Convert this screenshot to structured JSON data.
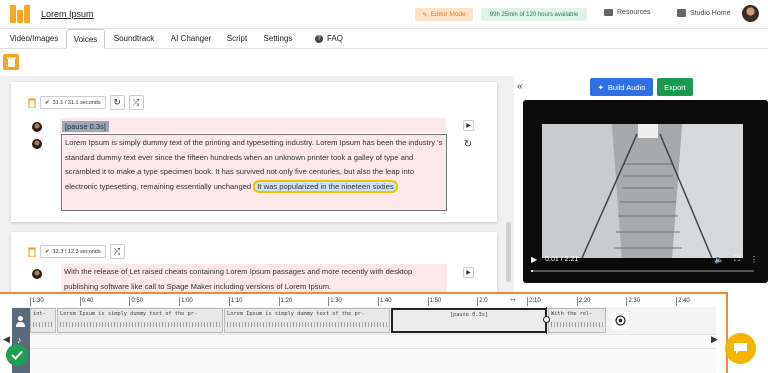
{
  "header": {
    "app_title": "Lorem Ipsum",
    "editor_mode": "Editor Mode",
    "hours": "99h 25min of 120 hours available",
    "resources": "Resources",
    "studio_home": "Studio Home"
  },
  "tabs": [
    {
      "label": "Video/Images"
    },
    {
      "label": "Voices"
    },
    {
      "label": "Soundtrack"
    },
    {
      "label": "AI Changer"
    },
    {
      "label": "Script"
    },
    {
      "label": "Settings"
    },
    {
      "label": "FAQ"
    }
  ],
  "blocks": [
    {
      "duration": "31.1 / 31.1 seconds",
      "pause": "[pause 0.3s]",
      "text": "Lorem Ipsum is simply dummy text of the printing and typesetting industry. Lorem Ipsum has been the industry 's standard dummy text ever since the fifteen hundreds when an unknown printer took a galley of type and scrambled it to make a type specimen book. It has survived not only five centuries, but also the leap into electronic typesetting, remaining essentially unchanged",
      "highlight": "It was popularized in the nineteen sixties"
    },
    {
      "duration": "12.3 / 12.3 seconds",
      "text": "With the release of Let raised cheats containing Lorem Ipsum passages and more recently with desktop publishing software like call to Spage Maker including versions of Lorem Ipsum."
    }
  ],
  "right_panel": {
    "build_audio": "Build Audio",
    "export": "Export",
    "video_time": "0:01 / 2:21",
    "progress": 0.01
  },
  "timeline": {
    "ticks": [
      "1:30",
      "|0:40",
      "|0:50",
      "|1:00",
      "|1:10",
      "|1:20",
      "|1:30",
      "|1:40",
      "|1:50",
      "|2:0",
      "|2:10",
      "|2:20",
      "|2:30",
      "|2:40"
    ],
    "segments": [
      {
        "text": "int-"
      },
      {
        "text": "Lorem Ipsum is simply dummy text of the pr-"
      },
      {
        "text": "Lorem Ipsum is simply dummy text of the pr-"
      },
      {
        "text": "[pause 0.3s]"
      },
      {
        "text": "With the rel-"
      }
    ]
  },
  "icons": {
    "trash": "trash-icon",
    "check": "check-icon",
    "refresh": "refresh-icon",
    "shuffle": "shuffle-icon",
    "play": "play-icon",
    "chat": "chat-icon"
  },
  "colors": {
    "accent": "#f5a623",
    "build_audio": "#2f6fe6",
    "export": "#1a9950",
    "highlight_border": "#f5c000",
    "timeline_border": "#f08a3b"
  }
}
